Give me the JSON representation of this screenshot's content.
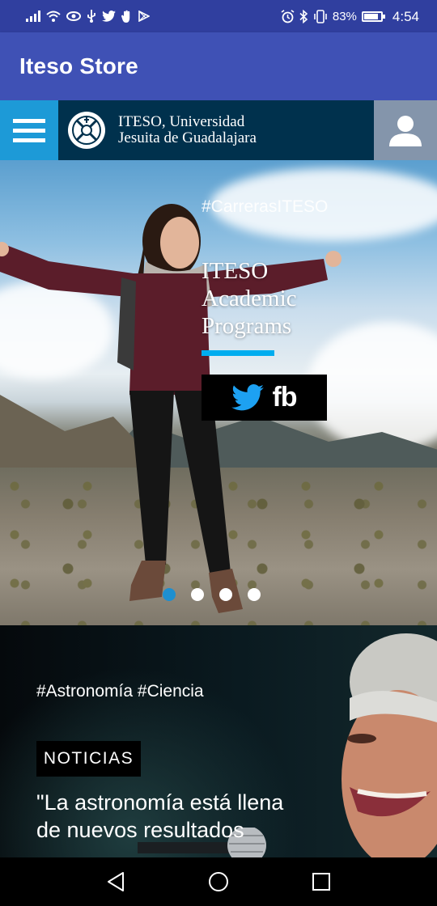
{
  "status_bar": {
    "battery": "83%",
    "battery_level": 0.83,
    "time": "4:54",
    "left_icons": [
      "signal-icon",
      "wifi-icon",
      "eye-icon",
      "usb-icon",
      "twitter-icon",
      "hand-icon",
      "play-store-icon"
    ],
    "right_icons": [
      "alarm-icon",
      "bluetooth-icon",
      "vibrate-icon",
      "battery-icon"
    ]
  },
  "app_bar": {
    "title": "Iteso Store",
    "color": "#3f51b5"
  },
  "site_header": {
    "logo_line1": "ITESO, Universidad",
    "logo_line2": "Jesuita de Guadalajara",
    "menu_icon": "hamburger-menu-icon",
    "user_icon": "user-icon",
    "colors": {
      "menu": "#1d9ad7",
      "logo_bg": "#00314d",
      "user": "#8495ab"
    }
  },
  "hero": {
    "hashtag": "#CarrerasITESO",
    "title_line1": "ITESO",
    "title_line2": "Academic",
    "title_line3": "Programs",
    "social_fb": "fb",
    "accent": "#00adef",
    "carousel": {
      "total": 4,
      "active": 1
    }
  },
  "news": {
    "tags": "#Astronomía #Ciencia",
    "badge": "NOTICIAS",
    "headline": "\"La astronomía está llena de nuevos resultados"
  },
  "nav_bar": {
    "icons": [
      "back-icon",
      "home-icon",
      "recents-icon"
    ]
  }
}
